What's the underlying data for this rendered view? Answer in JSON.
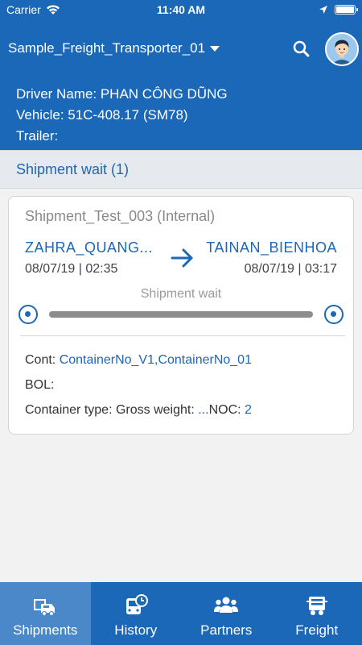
{
  "status_bar": {
    "carrier": "Carrier",
    "time": "11:40 AM"
  },
  "header": {
    "transporter": "Sample_Freight_Transporter_01",
    "driver_line": "Driver Name: PHAN CÔNG DŨNG",
    "vehicle_line": "Vehicle: 51C-408.17 (SM78)",
    "trailer_line": "Trailer:"
  },
  "section": {
    "title": "Shipment wait (1)"
  },
  "shipment": {
    "title": "Shipment_Test_003 (Internal)",
    "from": {
      "name": "ZAHRA_QUANG...",
      "datetime": "08/07/19 | 02:35"
    },
    "to": {
      "name": "TAINAN_BIENHOA",
      "datetime": "08/07/19 | 03:17"
    },
    "status": "Shipment wait",
    "cont_label": "Cont:",
    "cont_value": "ContainerNo_V1,ContainerNo_01",
    "bol_label": "BOL:",
    "container_type_label": "Container type:",
    "gross_weight_label": "Gross weight:",
    "gross_weight_value": "...",
    "noc_label": "NOC:",
    "noc_value": "2"
  },
  "tabs": [
    {
      "label": "Shipments",
      "icon": "truck-icon",
      "active": true
    },
    {
      "label": "History",
      "icon": "bus-clock-icon",
      "active": false
    },
    {
      "label": "Partners",
      "icon": "people-icon",
      "active": false
    },
    {
      "label": "Freight",
      "icon": "trailer-icon",
      "active": false
    }
  ],
  "colors": {
    "primary": "#1b67b8",
    "active_tab": "#4a88c9",
    "section_bg": "#e6eaef"
  }
}
